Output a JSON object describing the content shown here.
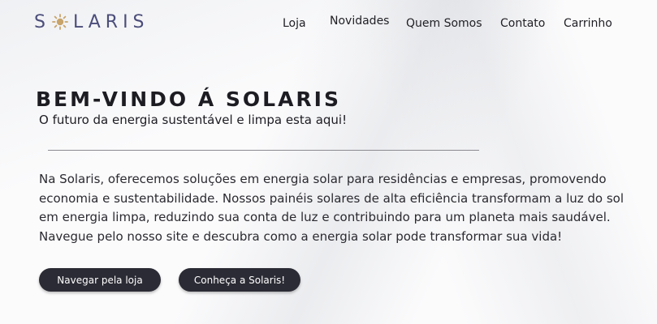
{
  "brand": {
    "name_left": "S",
    "name_right": "LARIS",
    "icon": "sun-icon",
    "color": "#4b4d7a",
    "accent": "#c8a46a"
  },
  "nav": {
    "items": [
      {
        "label": "Loja"
      },
      {
        "label": "Novidades"
      },
      {
        "label": "Quem Somos"
      },
      {
        "label": "Contato"
      },
      {
        "label": "Carrinho"
      }
    ]
  },
  "hero": {
    "title": "BEM-VINDO Á SOLARIS",
    "subtitle": "O futuro da energia sustentável e limpa esta aqui!",
    "body": "Na Solaris, oferecemos soluções em energia solar para residências e empresas, promovendo economia e sustentabilidade. Nossos painéis solares de alta eficiência transformam a luz do sol em energia limpa, reduzindo sua conta de luz e contribuindo para um planeta mais saudável. Navegue pelo nosso site e descubra como a energia solar pode transformar sua vida!",
    "buttons": {
      "shop_label": "Navegar pela loja",
      "about_label": "Conheça a Solaris!"
    }
  },
  "colors": {
    "button_bg": "#2b2b35",
    "text": "#1c1c22"
  }
}
